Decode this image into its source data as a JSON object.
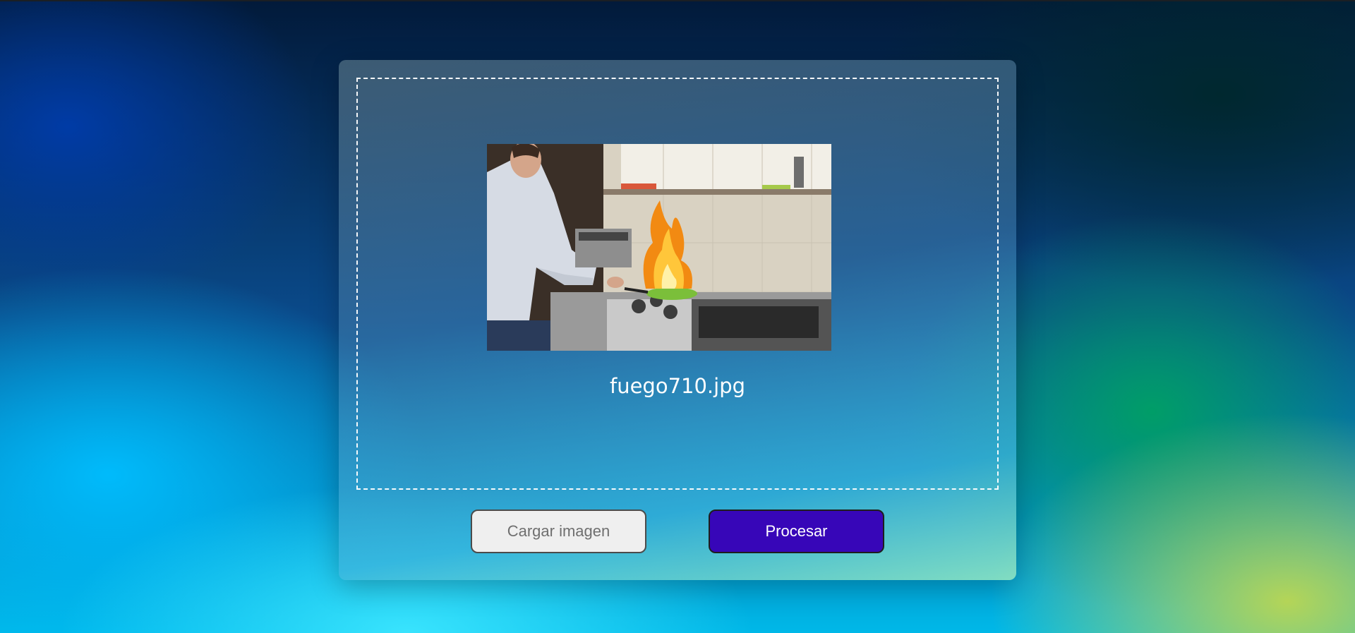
{
  "upload": {
    "filename": "fuego710.jpg",
    "preview_alt": "chef cooking with fire in kitchen"
  },
  "buttons": {
    "load_label": "Cargar imagen",
    "process_label": "Procesar"
  },
  "colors": {
    "process_button": "#3706b8",
    "load_button": "#efefef",
    "dropzone_border": "#ffffff"
  }
}
